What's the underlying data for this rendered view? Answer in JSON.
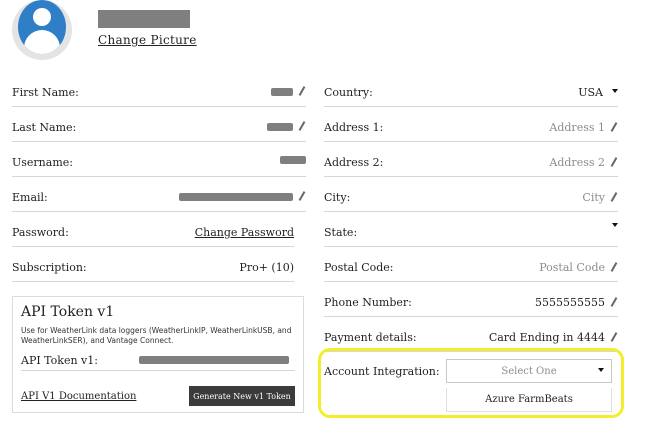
{
  "header": {
    "change_picture": "Change Picture"
  },
  "left": {
    "first_name": {
      "label": "First Name:"
    },
    "last_name": {
      "label": "Last Name:"
    },
    "username": {
      "label": "Username:"
    },
    "email": {
      "label": "Email:"
    },
    "password": {
      "label": "Password:",
      "action": "Change Password"
    },
    "subscription": {
      "label": "Subscription:",
      "value": "Pro+ (10)"
    }
  },
  "right": {
    "country": {
      "label": "Country:",
      "value": "USA"
    },
    "address1": {
      "label": "Address 1:",
      "placeholder": "Address 1"
    },
    "address2": {
      "label": "Address 2:",
      "placeholder": "Address 2"
    },
    "city": {
      "label": "City:",
      "placeholder": "City"
    },
    "state": {
      "label": "State:"
    },
    "postal_code": {
      "label": "Postal Code:",
      "placeholder": "Postal Code"
    },
    "phone": {
      "label": "Phone Number:",
      "value": "5555555555"
    },
    "payment": {
      "label": "Payment details:",
      "value": "Card Ending in 4444"
    }
  },
  "api_token": {
    "title": "API Token v1",
    "description": "Use for WeatherLink data loggers (WeatherLinkIP, WeatherLinkUSB, and WeatherLinkSER), and Vantage Connect.",
    "token_label": "API Token v1:",
    "doc_link": "API V1 Documentation",
    "generate_button": "Generate New v1 Token"
  },
  "account_integration": {
    "label": "Account Integration:",
    "select_placeholder": "Select One",
    "options": [
      "Azure FarmBeats"
    ]
  },
  "colors": {
    "avatar_blue": "#2f7fc6",
    "highlight": "#f2ee2c",
    "button_bg": "#3b3b3b",
    "redaction": "#7f7f7f"
  }
}
